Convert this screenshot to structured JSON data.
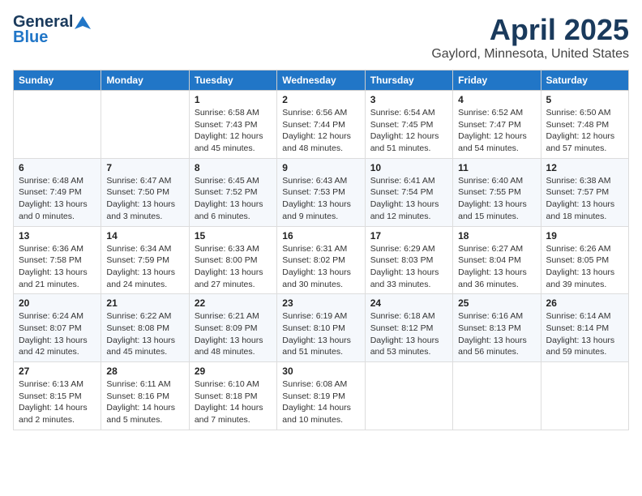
{
  "header": {
    "logo_general": "General",
    "logo_blue": "Blue",
    "title": "April 2025",
    "subtitle": "Gaylord, Minnesota, United States"
  },
  "weekdays": [
    "Sunday",
    "Monday",
    "Tuesday",
    "Wednesday",
    "Thursday",
    "Friday",
    "Saturday"
  ],
  "weeks": [
    [
      {
        "day": "",
        "info": ""
      },
      {
        "day": "",
        "info": ""
      },
      {
        "day": "1",
        "info": "Sunrise: 6:58 AM\nSunset: 7:43 PM\nDaylight: 12 hours and 45 minutes."
      },
      {
        "day": "2",
        "info": "Sunrise: 6:56 AM\nSunset: 7:44 PM\nDaylight: 12 hours and 48 minutes."
      },
      {
        "day": "3",
        "info": "Sunrise: 6:54 AM\nSunset: 7:45 PM\nDaylight: 12 hours and 51 minutes."
      },
      {
        "day": "4",
        "info": "Sunrise: 6:52 AM\nSunset: 7:47 PM\nDaylight: 12 hours and 54 minutes."
      },
      {
        "day": "5",
        "info": "Sunrise: 6:50 AM\nSunset: 7:48 PM\nDaylight: 12 hours and 57 minutes."
      }
    ],
    [
      {
        "day": "6",
        "info": "Sunrise: 6:48 AM\nSunset: 7:49 PM\nDaylight: 13 hours and 0 minutes."
      },
      {
        "day": "7",
        "info": "Sunrise: 6:47 AM\nSunset: 7:50 PM\nDaylight: 13 hours and 3 minutes."
      },
      {
        "day": "8",
        "info": "Sunrise: 6:45 AM\nSunset: 7:52 PM\nDaylight: 13 hours and 6 minutes."
      },
      {
        "day": "9",
        "info": "Sunrise: 6:43 AM\nSunset: 7:53 PM\nDaylight: 13 hours and 9 minutes."
      },
      {
        "day": "10",
        "info": "Sunrise: 6:41 AM\nSunset: 7:54 PM\nDaylight: 13 hours and 12 minutes."
      },
      {
        "day": "11",
        "info": "Sunrise: 6:40 AM\nSunset: 7:55 PM\nDaylight: 13 hours and 15 minutes."
      },
      {
        "day": "12",
        "info": "Sunrise: 6:38 AM\nSunset: 7:57 PM\nDaylight: 13 hours and 18 minutes."
      }
    ],
    [
      {
        "day": "13",
        "info": "Sunrise: 6:36 AM\nSunset: 7:58 PM\nDaylight: 13 hours and 21 minutes."
      },
      {
        "day": "14",
        "info": "Sunrise: 6:34 AM\nSunset: 7:59 PM\nDaylight: 13 hours and 24 minutes."
      },
      {
        "day": "15",
        "info": "Sunrise: 6:33 AM\nSunset: 8:00 PM\nDaylight: 13 hours and 27 minutes."
      },
      {
        "day": "16",
        "info": "Sunrise: 6:31 AM\nSunset: 8:02 PM\nDaylight: 13 hours and 30 minutes."
      },
      {
        "day": "17",
        "info": "Sunrise: 6:29 AM\nSunset: 8:03 PM\nDaylight: 13 hours and 33 minutes."
      },
      {
        "day": "18",
        "info": "Sunrise: 6:27 AM\nSunset: 8:04 PM\nDaylight: 13 hours and 36 minutes."
      },
      {
        "day": "19",
        "info": "Sunrise: 6:26 AM\nSunset: 8:05 PM\nDaylight: 13 hours and 39 minutes."
      }
    ],
    [
      {
        "day": "20",
        "info": "Sunrise: 6:24 AM\nSunset: 8:07 PM\nDaylight: 13 hours and 42 minutes."
      },
      {
        "day": "21",
        "info": "Sunrise: 6:22 AM\nSunset: 8:08 PM\nDaylight: 13 hours and 45 minutes."
      },
      {
        "day": "22",
        "info": "Sunrise: 6:21 AM\nSunset: 8:09 PM\nDaylight: 13 hours and 48 minutes."
      },
      {
        "day": "23",
        "info": "Sunrise: 6:19 AM\nSunset: 8:10 PM\nDaylight: 13 hours and 51 minutes."
      },
      {
        "day": "24",
        "info": "Sunrise: 6:18 AM\nSunset: 8:12 PM\nDaylight: 13 hours and 53 minutes."
      },
      {
        "day": "25",
        "info": "Sunrise: 6:16 AM\nSunset: 8:13 PM\nDaylight: 13 hours and 56 minutes."
      },
      {
        "day": "26",
        "info": "Sunrise: 6:14 AM\nSunset: 8:14 PM\nDaylight: 13 hours and 59 minutes."
      }
    ],
    [
      {
        "day": "27",
        "info": "Sunrise: 6:13 AM\nSunset: 8:15 PM\nDaylight: 14 hours and 2 minutes."
      },
      {
        "day": "28",
        "info": "Sunrise: 6:11 AM\nSunset: 8:16 PM\nDaylight: 14 hours and 5 minutes."
      },
      {
        "day": "29",
        "info": "Sunrise: 6:10 AM\nSunset: 8:18 PM\nDaylight: 14 hours and 7 minutes."
      },
      {
        "day": "30",
        "info": "Sunrise: 6:08 AM\nSunset: 8:19 PM\nDaylight: 14 hours and 10 minutes."
      },
      {
        "day": "",
        "info": ""
      },
      {
        "day": "",
        "info": ""
      },
      {
        "day": "",
        "info": ""
      }
    ]
  ]
}
